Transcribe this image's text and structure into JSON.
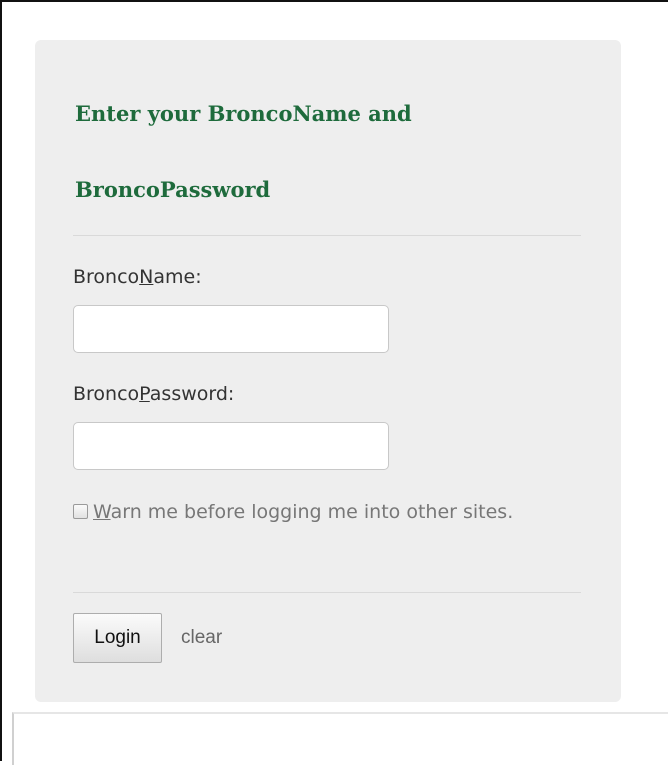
{
  "login": {
    "heading_line1": "Enter your BroncoName and",
    "heading_line2": "BroncoPassword",
    "username": {
      "label_before": "Bronco",
      "label_underlined": "N",
      "label_after": "ame:",
      "value": ""
    },
    "password": {
      "label_before": "Bronco",
      "label_underlined": "P",
      "label_after": "assword:",
      "value": ""
    },
    "warn": {
      "checked": false,
      "label_underlined": "W",
      "label_rest": "arn me before logging me into other sites."
    },
    "login_button_label": "Login",
    "clear_link_label": "clear"
  },
  "colors": {
    "heading": "#1e6b3c",
    "panel_background": "#eeeeee",
    "label_text": "#333333",
    "muted_text": "#777777"
  }
}
